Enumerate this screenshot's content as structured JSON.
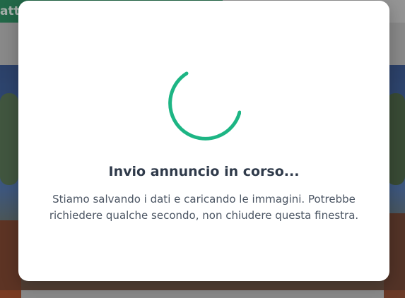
{
  "background": {
    "top_button_label": "atti"
  },
  "modal": {
    "title": "Invio annuncio in corso...",
    "message": "Stiamo salvando i dati e caricando le immagini. Potrebbe richiedere qualche secondo, non chiudere questa finestra."
  },
  "colors": {
    "spinner": "#1db584",
    "title": "#2f3a4a",
    "message": "#4b5563"
  }
}
